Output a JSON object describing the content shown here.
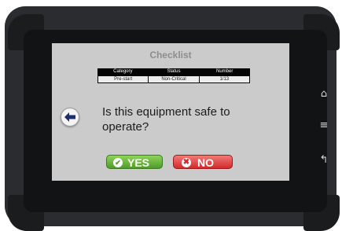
{
  "screen": {
    "title": "Checklist",
    "info_table": {
      "headers": [
        "Category",
        "Status",
        "Number"
      ],
      "row": [
        "Pre-start",
        "Non-Critical",
        "1/13"
      ]
    },
    "question": "Is this equipment safe to operate?",
    "buttons": {
      "yes_label": "YES",
      "no_label": "NO"
    }
  },
  "device": {
    "home_icon": "⌂",
    "menu_icon": "≡",
    "back_icon": "↰"
  },
  "colors": {
    "screen_bg": "#cbcbcb",
    "yes_green": "#5fae34",
    "no_red": "#d42a2a",
    "table_header": "#050505"
  },
  "icons": [
    "back-arrow-icon",
    "check-icon",
    "cross-icon",
    "home-icon",
    "menu-icon",
    "return-icon"
  ]
}
